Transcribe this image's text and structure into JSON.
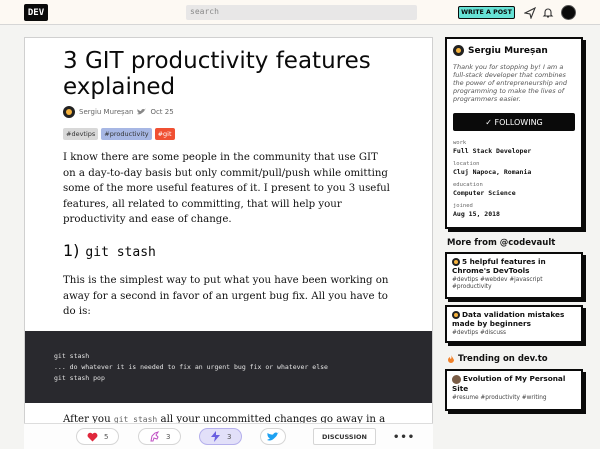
{
  "nav": {
    "logo": "DEV",
    "search_placeholder": "search",
    "write_label": "WRITE A POST"
  },
  "article": {
    "title": "3 GIT productivity features explained",
    "author": "Sergiu Mureșan",
    "date": "Oct 25",
    "tags": [
      {
        "label": "#devtips",
        "color": "#d8d8d8"
      },
      {
        "label": "#productivity",
        "color": "#a7b7e4"
      },
      {
        "label": "#git",
        "color": "#f05033"
      }
    ],
    "intro": "I know there are some people in the community that use GIT on a day-to-day basis but only commit/pull/push while omitting some of the more useful features of it. I present to you 3 useful features, all related to committing, that will help your productivity and ease of change.",
    "h2_number": "1)",
    "h2_code": "git stash",
    "para2": "This is the simplest way to put what you have been working on away for a second in favor of an urgent bug fix. All you have to do is:",
    "code_lines": [
      "git stash",
      "... do whatever it is needed to fix an urgent bug fix or whatever else",
      "git stash pop"
    ],
    "after_prefix": "After you",
    "after_code": "git stash",
    "after_suffix": "all your uncommitted changes go away in a"
  },
  "reactions": {
    "hearts": "5",
    "unicorns": "3",
    "bookmarks": "3",
    "discussion_label": "DISCUSSION",
    "more_label": "•••"
  },
  "profile": {
    "name": "Sergiu Mureșan",
    "bio": "Thank you for stopping by! I am a full-stack developer that combines the power of entrepreneurship and programming to make the lives of programmers easier.",
    "follow_label": "✓ FOLLOWING",
    "fields": [
      {
        "label": "work",
        "value": "Full Stack Developer"
      },
      {
        "label": "location",
        "value": "Cluj Napoca, Romania"
      },
      {
        "label": "education",
        "value": "Computer Science"
      },
      {
        "label": "joined",
        "value": "Aug 15, 2018"
      }
    ]
  },
  "more_from": {
    "title": "More from @codevault",
    "items": [
      {
        "title": "5 helpful features in Chrome's DevTools",
        "tags": "#devtips #webdev #javascript #productivity"
      },
      {
        "title": "Data validation mistakes made by beginners",
        "tags": "#devtips #discuss"
      }
    ]
  },
  "trending": {
    "title": "Trending on dev.to",
    "items": [
      {
        "title": "Evolution of My Personal Site",
        "tags": "#resume #productivity #writing"
      }
    ]
  }
}
